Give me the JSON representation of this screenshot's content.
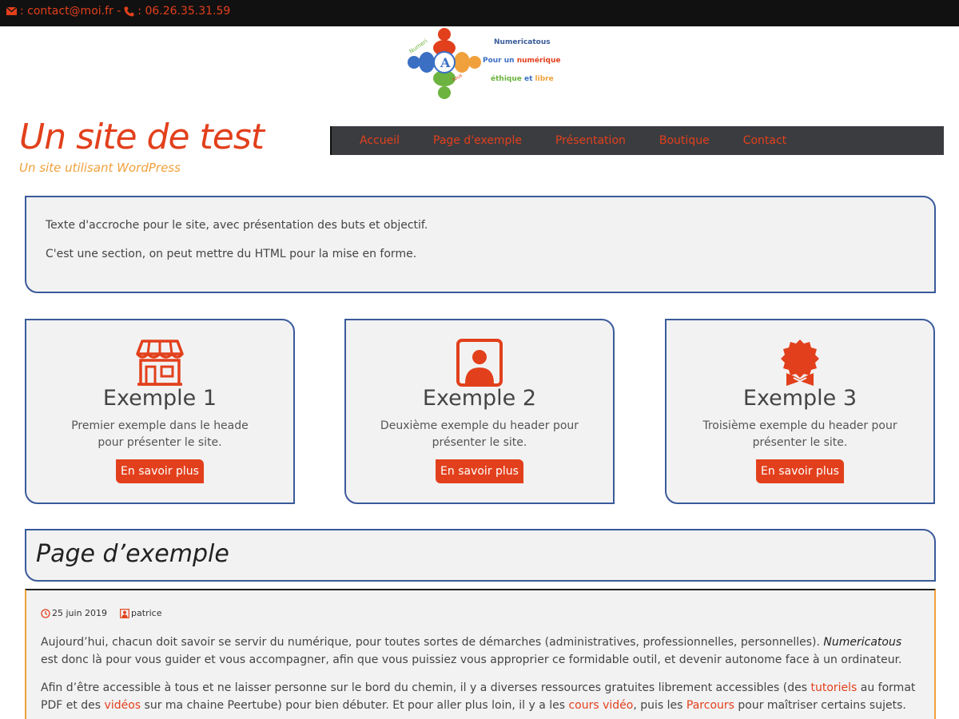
{
  "topbar": {
    "email": ": contact@moi.fr -",
    "phone": ": 06.26.35.31.59"
  },
  "logo": {
    "line1": "Numericatous",
    "line2a": "Pour un",
    "line2b": "numérique",
    "line3a": "éthique",
    "line3b": "et",
    "line3c": "libre"
  },
  "site": {
    "title": "Un site de test",
    "tagline": "Un site utilisant WordPress"
  },
  "nav": {
    "items": [
      "Accueil",
      "Page d'exemple",
      "Présentation",
      "Boutique",
      "Contact"
    ]
  },
  "intro": {
    "line1": "Texte d'accroche pour le site, avec présentation des buts et objectif.",
    "line2": "C'est une section, on peut mettre du HTML pour la mise en forme."
  },
  "cards": [
    {
      "title": "Exemple 1",
      "desc": "Premier exemple dans le heade pour présenter le site.",
      "button": "En savoir plus",
      "icon": "shop-icon"
    },
    {
      "title": "Exemple 2",
      "desc": "Deuxième exemple du header pour présenter le site.",
      "button": "En savoir plus",
      "icon": "user-portrait-icon"
    },
    {
      "title": "Exemple 3",
      "desc": "Troisième exemple du header pour présenter le site.",
      "button": "En savoir plus",
      "icon": "award-badge-icon"
    }
  ],
  "page": {
    "title": "Page d’exemple",
    "date": "25 juin 2019",
    "author": "patrice",
    "p1_a": "Aujourd’hui, chacun doit savoir se servir du numérique, pour toutes sortes de démarches (administratives, professionnelles, personnelles). ",
    "p1_em": "Numericatous",
    "p1_b": " est donc là pour vous guider et vous accompagner, afin que vous puissiez vous approprier ce formidable outil, et devenir autonome face à un ordinateur.",
    "p2_a": "Afin d’être accessible à tous et ne laisser personne sur le bord du chemin, il y a diverses ressources gratuites librement accessibles (des ",
    "p2_link1": "tutoriels",
    "p2_b": " au format PDF et des ",
    "p2_link2": "vidéos",
    "p2_c": " sur ma chaine Peertube) pour bien débuter. Et pour aller plus loin, il y a les ",
    "p2_link3": "cours vidéo",
    "p2_d": ", puis les ",
    "p2_link4": "Parcours",
    "p2_e": " pour maîtriser certains sujets."
  },
  "colors": {
    "accent": "#e2401c",
    "tagline": "#f0a13c",
    "border": "#3a5a9a",
    "nav_bg": "#3b3c40",
    "topbar_bg": "#111111"
  }
}
